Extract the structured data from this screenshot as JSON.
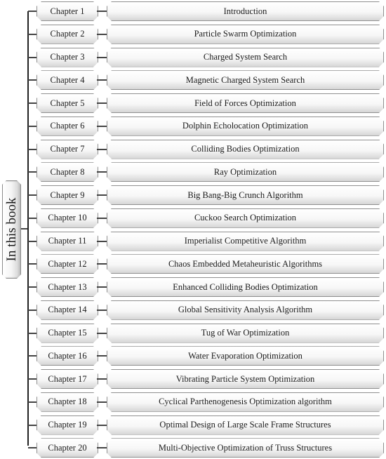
{
  "root_label": "In this book",
  "chapters": [
    {
      "chapter": "Chapter 1",
      "title": "Introduction"
    },
    {
      "chapter": "Chapter 2",
      "title": "Particle Swarm Optimization"
    },
    {
      "chapter": "Chapter 3",
      "title": "Charged System Search"
    },
    {
      "chapter": "Chapter 4",
      "title": "Magnetic Charged System Search"
    },
    {
      "chapter": "Chapter 5",
      "title": "Field of Forces Optimization"
    },
    {
      "chapter": "Chapter 6",
      "title": "Dolphin Echolocation Optimization"
    },
    {
      "chapter": "Chapter 7",
      "title": "Colliding Bodies Optimization"
    },
    {
      "chapter": "Chapter 8",
      "title": "Ray Optimization"
    },
    {
      "chapter": "Chapter 9",
      "title": "Big Bang-Big Crunch Algorithm"
    },
    {
      "chapter": "Chapter 10",
      "title": "Cuckoo Search Optimization"
    },
    {
      "chapter": "Chapter 11",
      "title": "Imperialist Competitive Algorithm"
    },
    {
      "chapter": "Chapter 12",
      "title": "Chaos Embedded Metaheuristic Algorithms"
    },
    {
      "chapter": "Chapter 13",
      "title": "Enhanced Colliding Bodies Optimization"
    },
    {
      "chapter": "Chapter 14",
      "title": "Global Sensitivity Analysis Algorithm"
    },
    {
      "chapter": "Chapter 15",
      "title": "Tug of War Optimization"
    },
    {
      "chapter": "Chapter 16",
      "title": "Water Evaporation Optimization"
    },
    {
      "chapter": "Chapter 17",
      "title": "Vibrating Particle System Optimization"
    },
    {
      "chapter": "Chapter 18",
      "title": "Cyclical Parthenogenesis Optimization algorithm"
    },
    {
      "chapter": "Chapter 19",
      "title": "Optimal Design of Large Scale Frame Structures"
    },
    {
      "chapter": "Chapter 20",
      "title": "Multi-Objective Optimization of Truss Structures"
    }
  ]
}
